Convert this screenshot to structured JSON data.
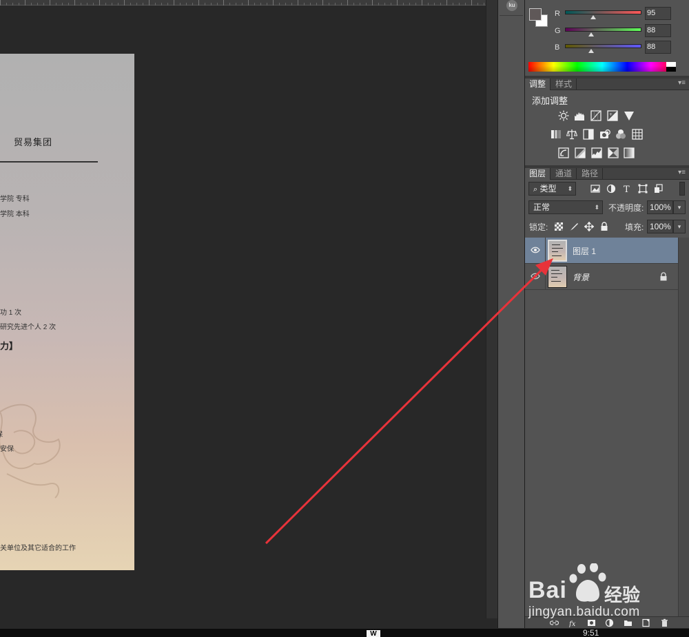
{
  "document": {
    "title": "贸易集团",
    "lines": [
      {
        "text": "学院      专科"
      },
      {
        "text": "学院      本科"
      },
      {
        "text": "功 1 次"
      },
      {
        "text": "研究先进个人 2 次"
      },
      {
        "text": "力】"
      },
      {
        "text": "保"
      },
      {
        "text": "安保"
      },
      {
        "text": "关单位及其它适合的工作"
      }
    ]
  },
  "strip": {
    "ku_label": "ku"
  },
  "color_panel": {
    "foreground": "#5f5858",
    "background": "#ffffff",
    "channels": [
      {
        "name": "R",
        "value": "95",
        "fraction": 0.373,
        "gradient": "linear-gradient(90deg,#005858,#ff5858)"
      },
      {
        "name": "G",
        "value": "88",
        "fraction": 0.345,
        "gradient": "linear-gradient(90deg,#5f0058,#5fff58)"
      },
      {
        "name": "B",
        "value": "88",
        "fraction": 0.345,
        "gradient": "linear-gradient(90deg,#5f5800,#5f58ff)"
      }
    ]
  },
  "adjustments": {
    "tabs": [
      "调整",
      "样式"
    ],
    "title": "添加调整",
    "icons": [
      "brightness-icon",
      "levels-icon",
      "curves-icon",
      "exposure-icon",
      "vibrance-icon",
      "hue-saturation-icon",
      "color-balance-icon",
      "black-white-icon",
      "photo-filter-icon",
      "channel-mixer-icon",
      "color-lookup-icon",
      "invert-icon",
      "posterize-icon",
      "threshold-icon",
      "selective-color-icon",
      "gradient-map-icon"
    ]
  },
  "layers": {
    "tabs": [
      "图层",
      "通道",
      "路径"
    ],
    "filter_label": "类型",
    "blend_mode": "正常",
    "opacity_label": "不透明度:",
    "opacity_value": "100%",
    "lock_label": "锁定:",
    "fill_label": "填充:",
    "fill_value": "100%",
    "items": [
      {
        "name": "图层 1",
        "selected": true,
        "visible": true,
        "locked": false
      },
      {
        "name": "背景",
        "selected": false,
        "visible": true,
        "locked": true
      }
    ]
  },
  "watermark": {
    "brand_left": "Bai",
    "brand_right": "经验",
    "url": "jingyan.baidu.com"
  },
  "taskbar": {
    "app_icon_label": "W",
    "clock": "9:51"
  },
  "accent": {
    "arrow": "#e8333a",
    "selection": "#6f8299"
  }
}
